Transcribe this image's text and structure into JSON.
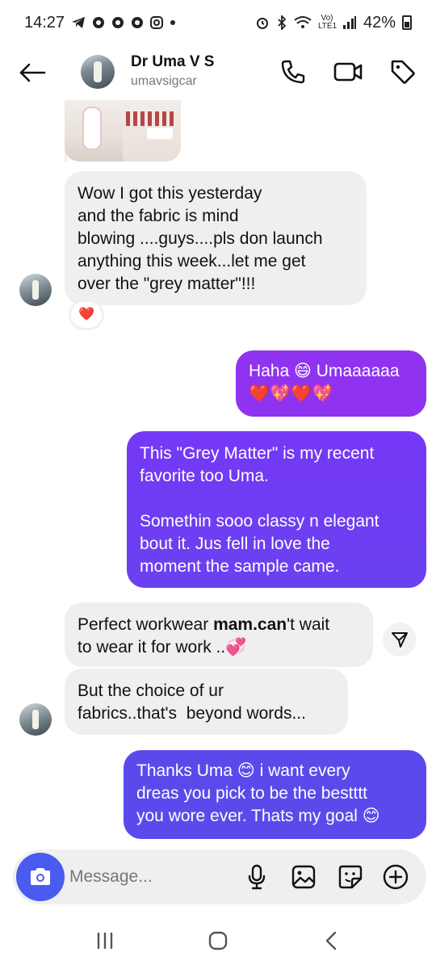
{
  "status_bar": {
    "time": "14:27",
    "battery": "42%",
    "network_label": "Vo) LTE1"
  },
  "header": {
    "name": "Dr Uma V S",
    "username": "umavsigcar",
    "icons": [
      "back-arrow-icon",
      "phone-icon",
      "video-call-icon",
      "tag-icon"
    ]
  },
  "messages": [
    {
      "side": "in",
      "text": "Wow I got this yesterday\nand the fabric is mind\nblowing ....guys....pls don launch\nanything this week...let me get\nover the \"grey matter\"!!!",
      "reaction": "❤️"
    },
    {
      "side": "out",
      "text": "Haha 😄 Umaaaaaa\n❤️💖❤️💖"
    },
    {
      "side": "out",
      "text": "This \"Grey Matter\" is my recent\nfavorite too Uma.\n\nSomethin sooo classy n elegant\nbout it. Jus fell in love the\nmoment the sample came."
    },
    {
      "side": "in",
      "text_before": "Perfect workwear ",
      "text_bold": "mam.can",
      "text_after": "'t wait\nto wear it for work ..💞"
    },
    {
      "side": "in",
      "text": "But the choice of ur\nfabrics..that's  beyond words..."
    },
    {
      "side": "out",
      "text": "Thanks Uma 😊 i want every\ndreas you pick to be the bestttt\nyou wore ever. Thats my goal 😊"
    }
  ],
  "composer": {
    "placeholder": "Message...",
    "icons": [
      "camera-icon",
      "microphone-icon",
      "gallery-icon",
      "sticker-icon",
      "plus-icon"
    ]
  },
  "colors": {
    "out_top": "#9a2ef0",
    "out_mid": "#7a3cf4",
    "out_bottom": "#5b49ec",
    "camera_button": "#4a5cf0",
    "incoming_bubble": "#efefef"
  }
}
